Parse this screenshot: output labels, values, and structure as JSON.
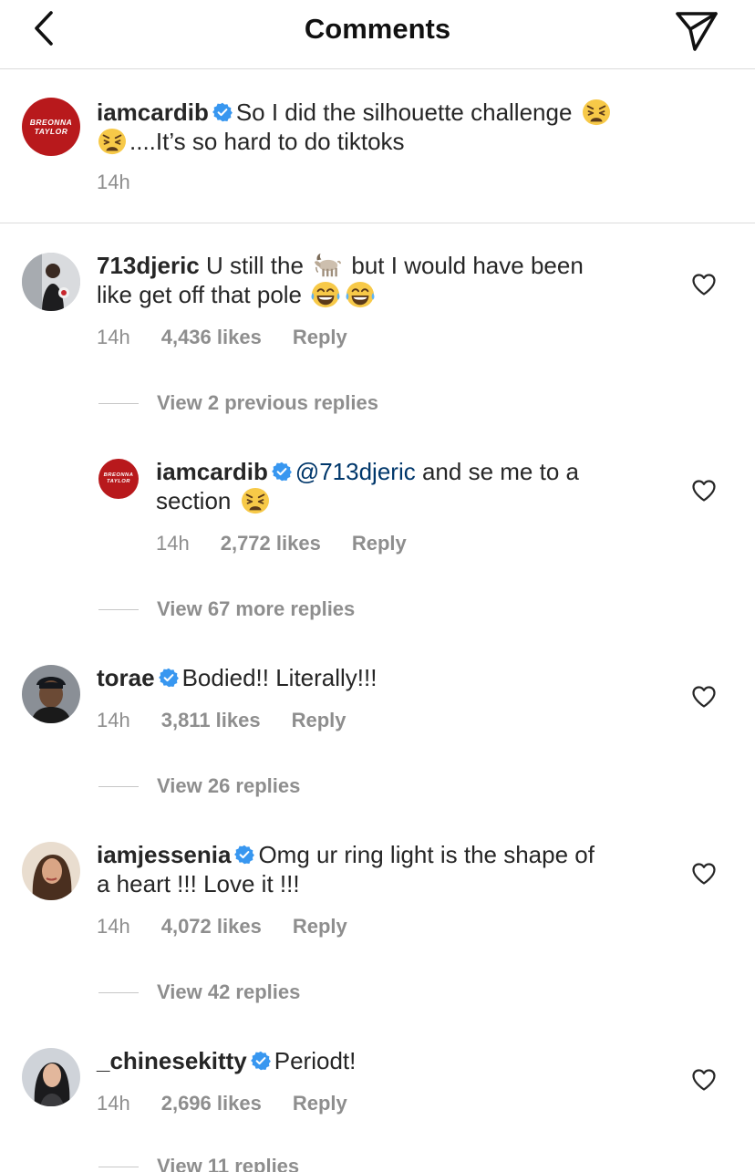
{
  "header": {
    "title": "Comments",
    "back_icon": "chevron-left-icon",
    "share_icon": "paper-plane-icon"
  },
  "colors": {
    "text": "#262626",
    "secondary": "#8e8e8e",
    "mention": "#00376b",
    "verified": "#3897f0",
    "divider": "#dbdbdb",
    "avatar_red": "#b8191c"
  },
  "caption": {
    "avatar_text_1": "BREONNA",
    "avatar_text_2": "TAYLOR",
    "username": "iamcardib",
    "text_1": "So I did the silhouette challenge",
    "text_2": "....It’s so hard to do tiktoks",
    "time": "14h"
  },
  "comments": [
    {
      "username": "713djeric",
      "text_1": "U still the",
      "text_2": "but I would have been",
      "text_3": "like get off that pole",
      "time": "14h",
      "likes": "4,436 likes",
      "reply": "Reply",
      "view_replies": "View 2 previous replies"
    },
    {
      "username": "iamcardib",
      "avatar_text_1": "BREONNA",
      "avatar_text_2": "TAYLOR",
      "mention": "@713djeric",
      "text_1": "and se me to a",
      "text_2": "section",
      "time": "14h",
      "likes": "2,772 likes",
      "reply": "Reply",
      "view_replies": "View 67 more replies"
    },
    {
      "username": "torae",
      "text_1": "Bodied!! Literally!!!",
      "time": "14h",
      "likes": "3,811 likes",
      "reply": "Reply",
      "view_replies": "View 26 replies"
    },
    {
      "username": "iamjessenia",
      "text_1": "Omg ur ring light is the shape of",
      "text_2": "a heart !!! Love it !!!",
      "time": "14h",
      "likes": "4,072 likes",
      "reply": "Reply",
      "view_replies": "View 42 replies"
    },
    {
      "username": "_chinesekitty",
      "text_1": "Periodt!",
      "time": "14h",
      "likes": "2,696 likes",
      "reply": "Reply",
      "view_replies": "View 11 replies"
    }
  ]
}
